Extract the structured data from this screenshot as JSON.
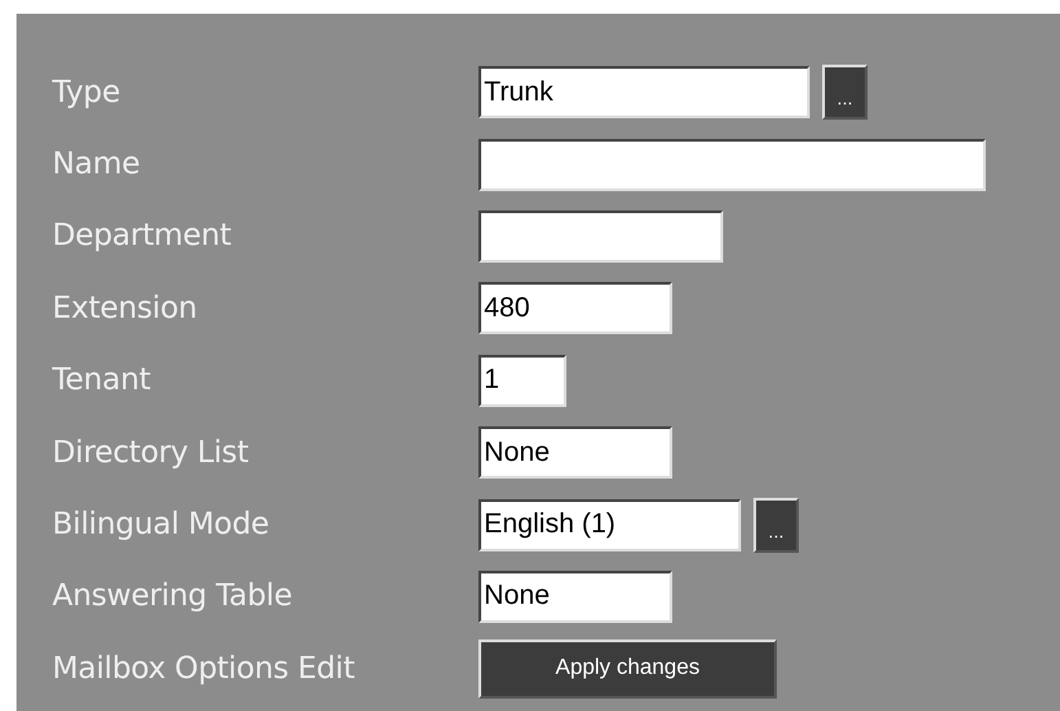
{
  "rows": [
    {
      "label": "Type",
      "kind": "field",
      "value": "Trunk",
      "browse": "..."
    },
    {
      "label": "Name",
      "kind": "field",
      "value": ""
    },
    {
      "label": "Department",
      "kind": "field",
      "value": ""
    },
    {
      "label": "Extension",
      "kind": "field",
      "value": "480"
    },
    {
      "label": "Tenant",
      "kind": "field",
      "value": "1"
    },
    {
      "label": "Directory List",
      "kind": "field",
      "value": "None"
    },
    {
      "label": "Bilingual Mode",
      "kind": "field",
      "value": "English (1)",
      "browse": "..."
    },
    {
      "label": "Answering Table",
      "kind": "field",
      "value": "None"
    },
    {
      "label": "Mailbox Options Edit",
      "kind": "button",
      "button": "Apply changes"
    }
  ]
}
